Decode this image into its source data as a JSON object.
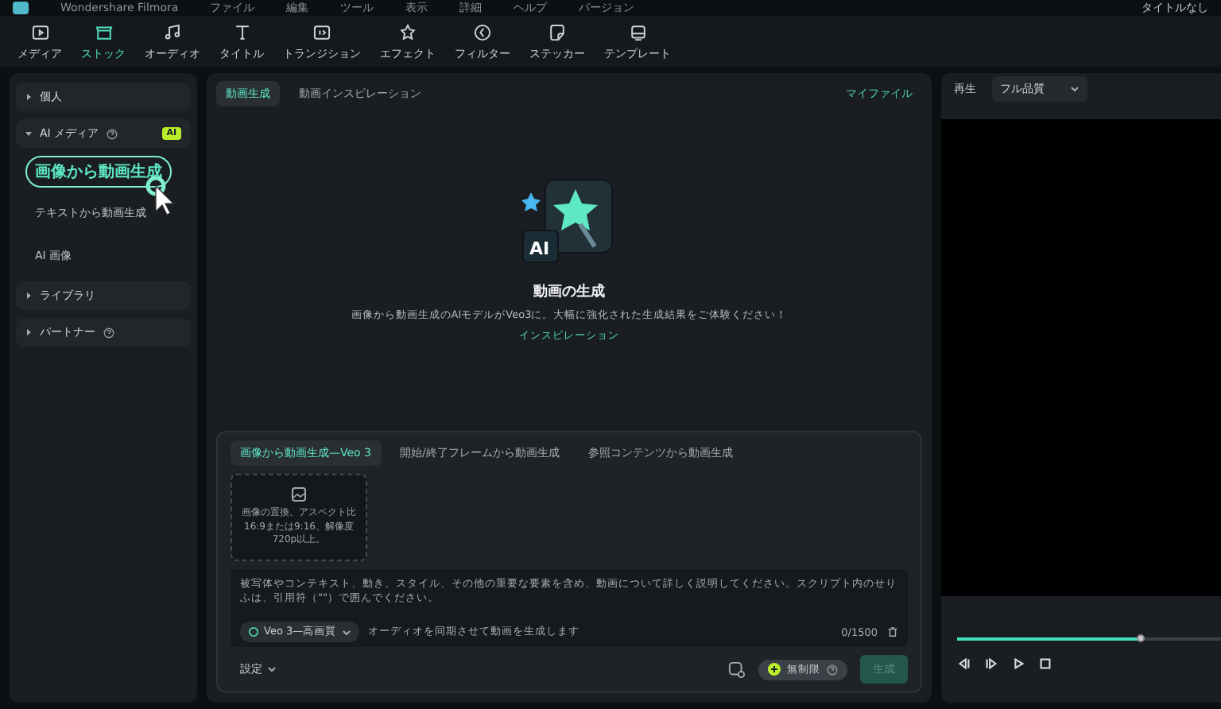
{
  "title_bar": {
    "app_name": "Wondershare Filmora",
    "menu": [
      "ファイル",
      "編集",
      "ツール",
      "表示",
      "詳細",
      "ヘルプ",
      "バージョン"
    ],
    "project": "タイトルなし"
  },
  "toolbar": [
    {
      "label": "メディア",
      "selected": false
    },
    {
      "label": "ストック",
      "selected": true
    },
    {
      "label": "オーディオ",
      "selected": false
    },
    {
      "label": "タイトル",
      "selected": false
    },
    {
      "label": "トランジション",
      "selected": false
    },
    {
      "label": "エフェクト",
      "selected": false
    },
    {
      "label": "フィルター",
      "selected": false
    },
    {
      "label": "ステッカー",
      "selected": false
    },
    {
      "label": "テンプレート",
      "selected": false
    }
  ],
  "sidebar": [
    {
      "label": "個人",
      "expanded": false,
      "help": false
    },
    {
      "label": "AI メディア",
      "expanded": true,
      "help": true,
      "badge": "AI",
      "children": [
        {
          "label": "画像から動画生成",
          "selected": true
        },
        {
          "label": "テキストから動画生成",
          "selected": false
        },
        {
          "label": "AI 画像",
          "selected": false
        }
      ]
    },
    {
      "label": "ライブラリ",
      "expanded": false,
      "help": false
    },
    {
      "label": "パートナー",
      "expanded": false,
      "help": true
    }
  ],
  "content_tabs": [
    {
      "label": "動画生成",
      "selected": true
    },
    {
      "label": "動画インスピレーション",
      "selected": false
    }
  ],
  "my_files": "マイファイル",
  "hero": {
    "icon_text": "AI",
    "title": "動画の生成",
    "description": "画像から動画生成のAIモデルがVeo3に。大幅に強化された生成結果をご体験ください！",
    "link": "インスピレーション"
  },
  "generator": {
    "tabs": [
      {
        "label": "画像から動画生成—Veo 3",
        "selected": true
      },
      {
        "label": "開始/終了フレームから動画生成",
        "selected": false
      },
      {
        "label": "参照コンテンツから動画生成",
        "selected": false
      }
    ],
    "upload_hint": "画像の置換、アスペクト比16:9または9:16、解像度720p以上。",
    "prompt": {
      "placeholder": "被写体やコンテキスト、動き、スタイル、その他の重要な要素を含め、動画について詳しく説明してください。スクリプト内のせりふは、引用符（\"\"）で囲んでください。"
    },
    "model": "Veo 3—高画質",
    "audio_note": "オーディオを同期させて動画を生成します",
    "counter": "0/1500",
    "settings": "設定",
    "credits": "無制限",
    "generate": {
      "label": "生成",
      "disabled": true
    }
  },
  "preview": {
    "label": "再生",
    "quality": "フル品質",
    "level": 0.7
  }
}
